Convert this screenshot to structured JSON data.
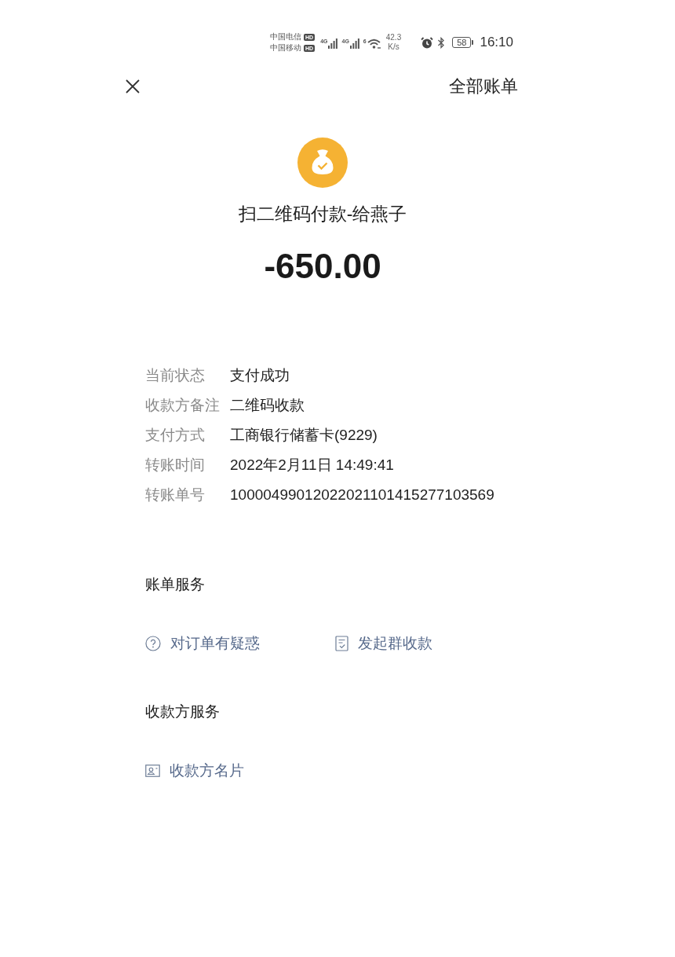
{
  "status_bar": {
    "carriers": [
      {
        "name": "中国电信",
        "badge": "HD"
      },
      {
        "name": "中国移动",
        "badge": "HD"
      }
    ],
    "networks": [
      {
        "type": "4G"
      },
      {
        "type": "4G"
      }
    ],
    "wifi": {
      "generation": "6"
    },
    "network_speed": {
      "value": "42.3",
      "unit": "K/s"
    },
    "battery": "58",
    "time": "16:10"
  },
  "header": {
    "all_bills": "全部账单"
  },
  "summary": {
    "title": "扫二维码付款-给燕子",
    "amount": "-650.00"
  },
  "details": [
    {
      "label": "当前状态",
      "value": "支付成功"
    },
    {
      "label": "收款方备注",
      "value": "二维码收款"
    },
    {
      "label": "支付方式",
      "value": "工商银行储蓄卡(9229)"
    },
    {
      "label": "转账时间",
      "value": "2022年2月11日 14:49:41"
    },
    {
      "label": "转账单号",
      "value": "10000499012022021101415277103569"
    }
  ],
  "sections": [
    {
      "title": "账单服务",
      "actions": [
        {
          "kind": "question",
          "label": "对订单有疑惑"
        },
        {
          "kind": "receipt",
          "label": "发起群收款"
        }
      ]
    },
    {
      "title": "收款方服务",
      "actions": [
        {
          "kind": "contact_card",
          "label": "收款方名片"
        }
      ]
    }
  ]
}
